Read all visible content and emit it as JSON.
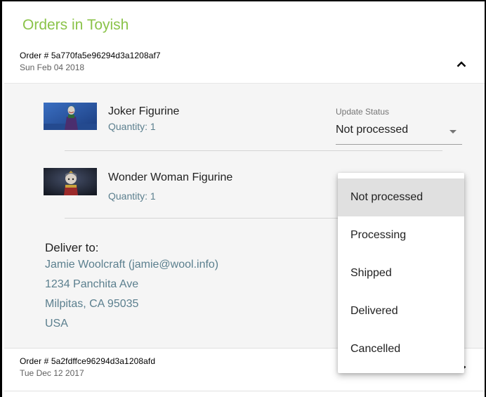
{
  "page": {
    "title": "Orders in Toyish"
  },
  "colors": {
    "accent": "#8bc34a",
    "link_text": "#5b7f8e",
    "panel_bg": "#f5f5f5",
    "selected_bg": "#e0e0e0"
  },
  "orders": [
    {
      "id_text": "Order # 5a770fa5e96294d3a1208af7",
      "date": "Sun Feb 04 2018",
      "expanded": true,
      "toggle_icon": "chevron-up-icon",
      "items": [
        {
          "name": "Joker Figurine",
          "quantity": "Quantity: 1",
          "image": "joker-figurine-thumbnail"
        },
        {
          "name": "Wonder Woman Figurine",
          "quantity": "Quantity: 1",
          "image": "wonder-woman-figurine-thumbnail"
        }
      ],
      "status": {
        "label": "Update Status",
        "value": "Not processed",
        "options": [
          "Not processed",
          "Processing",
          "Shipped",
          "Delivered",
          "Cancelled"
        ],
        "selected_index": 0,
        "menu_open": true
      },
      "delivery": {
        "title": "Deliver to:",
        "name_line": "Jamie Woolcraft (jamie@wool.info)",
        "street": "1234 Panchita Ave",
        "city_line": "Milpitas, CA 95035",
        "country": "USA"
      }
    },
    {
      "id_text": "Order # 5a2fdffce96294d3a1208afd",
      "date": "Tue Dec 12 2017",
      "expanded": false,
      "toggle_icon": "chevron-down-icon"
    }
  ]
}
